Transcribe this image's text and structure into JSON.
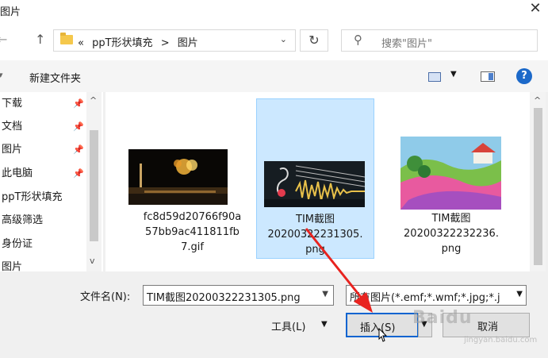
{
  "window": {
    "title": "图片",
    "close_glyph": "✕"
  },
  "nav_bar": {
    "back_glyph": "←",
    "up_glyph": "↑",
    "breadcrumb_prefix": "«",
    "breadcrumb": [
      "ppT形状填充",
      "图片"
    ],
    "separator": ">",
    "dropdown_glyph": "⌄",
    "refresh_glyph": "↻",
    "search_placeholder": "搜索\"图片\""
  },
  "toolbar": {
    "new_folder_label": "新建文件夹",
    "help_glyph": "?"
  },
  "sidebar": {
    "items": [
      {
        "label": "下载",
        "pinned": true
      },
      {
        "label": "文档",
        "pinned": true
      },
      {
        "label": "图片",
        "pinned": true
      },
      {
        "label": "此电脑",
        "pinned": true
      },
      {
        "label": "ppT形状填充",
        "pinned": false
      },
      {
        "label": "高级筛选",
        "pinned": false
      },
      {
        "label": "身份证",
        "pinned": false
      },
      {
        "label": "图片",
        "pinned": false
      }
    ]
  },
  "files": [
    {
      "name_lines": [
        "fc8d59d20766f90a",
        "57bb9ac411811fb",
        "7.gif"
      ],
      "selected": false,
      "thumbnail": "fireworks-night-photo"
    },
    {
      "name_lines": [
        "TIM截图",
        "20200322231305.",
        "png"
      ],
      "selected": true,
      "thumbnail": "music-waveform-image"
    },
    {
      "name_lines": [
        "TIM截图",
        "20200322232236.",
        "png"
      ],
      "selected": false,
      "thumbnail": "painted-landscape-house"
    }
  ],
  "footer": {
    "filename_label": "文件名(N):",
    "filename_value": "TIM截图20200322231305.png",
    "filetype_value": "所有图片(*.emf;*.wmf;*.jpg;*.j",
    "tools_label": "工具(L)",
    "insert_label": "插入(S)",
    "cancel_label": "取消"
  },
  "colors": {
    "accent": "#0a64d0",
    "selection_bg": "#cce8ff",
    "annotation_arrow": "#e8231f"
  },
  "watermark": {
    "text": "Baidu",
    "sub": "jingyan.baidu.com"
  }
}
